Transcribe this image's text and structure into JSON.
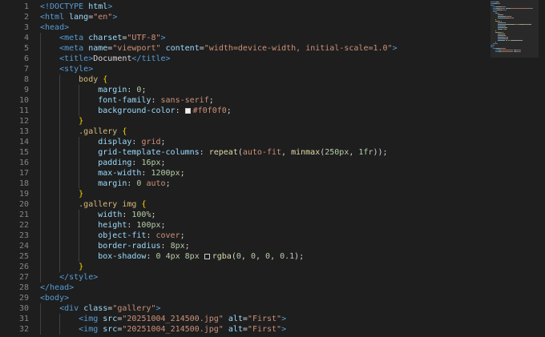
{
  "editor": {
    "lines": [
      {
        "n": "1",
        "indent": 0,
        "tokens": [
          [
            "tag",
            "<!DOCTYPE "
          ],
          [
            "attr",
            "html"
          ],
          [
            "tag",
            ">"
          ]
        ]
      },
      {
        "n": "2",
        "indent": 0,
        "tokens": [
          [
            "tag",
            "<html "
          ],
          [
            "attr",
            "lang"
          ],
          [
            "punct",
            "="
          ],
          [
            "str",
            "\"en\""
          ],
          [
            "tag",
            ">"
          ]
        ]
      },
      {
        "n": "3",
        "indent": 0,
        "tokens": [
          [
            "tag",
            "<head>"
          ]
        ]
      },
      {
        "n": "4",
        "indent": 1,
        "tokens": [
          [
            "tag",
            "<meta "
          ],
          [
            "attr",
            "charset"
          ],
          [
            "punct",
            "="
          ],
          [
            "str",
            "\"UTF-8\""
          ],
          [
            "tag",
            ">"
          ]
        ]
      },
      {
        "n": "5",
        "indent": 1,
        "tokens": [
          [
            "tag",
            "<meta "
          ],
          [
            "attr",
            "name"
          ],
          [
            "punct",
            "="
          ],
          [
            "str",
            "\"viewport\""
          ],
          [
            "text",
            " "
          ],
          [
            "attr",
            "content"
          ],
          [
            "punct",
            "="
          ],
          [
            "str",
            "\"width=device-width, initial-scale=1.0\""
          ],
          [
            "tag",
            ">"
          ]
        ]
      },
      {
        "n": "6",
        "indent": 1,
        "tokens": [
          [
            "tag",
            "<title>"
          ],
          [
            "text",
            "Document"
          ],
          [
            "tag",
            "</title>"
          ]
        ]
      },
      {
        "n": "7",
        "indent": 1,
        "tokens": [
          [
            "tag",
            "<style>"
          ]
        ]
      },
      {
        "n": "8",
        "indent": 2,
        "tokens": [
          [
            "sel",
            "body"
          ],
          [
            "text",
            " "
          ],
          [
            "brace",
            "{"
          ]
        ]
      },
      {
        "n": "9",
        "indent": 3,
        "tokens": [
          [
            "prop",
            "margin"
          ],
          [
            "punct",
            ": "
          ],
          [
            "num",
            "0"
          ],
          [
            "punct",
            ";"
          ]
        ]
      },
      {
        "n": "10",
        "indent": 3,
        "tokens": [
          [
            "prop",
            "font-family"
          ],
          [
            "punct",
            ": "
          ],
          [
            "val",
            "sans-serif"
          ],
          [
            "punct",
            ";"
          ]
        ]
      },
      {
        "n": "11",
        "indent": 3,
        "tokens": [
          [
            "prop",
            "background-color"
          ],
          [
            "punct",
            ": "
          ],
          [
            "swatch",
            "#f0f0f0"
          ],
          [
            "val",
            "#f0f0f0"
          ],
          [
            "punct",
            ";"
          ]
        ]
      },
      {
        "n": "12",
        "indent": 2,
        "tokens": [
          [
            "brace",
            "}"
          ]
        ]
      },
      {
        "n": "13",
        "indent": 2,
        "tokens": [
          [
            "sel",
            ".gallery"
          ],
          [
            "text",
            " "
          ],
          [
            "brace",
            "{"
          ]
        ]
      },
      {
        "n": "14",
        "indent": 3,
        "tokens": [
          [
            "prop",
            "display"
          ],
          [
            "punct",
            ": "
          ],
          [
            "val",
            "grid"
          ],
          [
            "punct",
            ";"
          ]
        ]
      },
      {
        "n": "15",
        "indent": 3,
        "tokens": [
          [
            "prop",
            "grid-template-columns"
          ],
          [
            "punct",
            ": "
          ],
          [
            "fn",
            "repeat"
          ],
          [
            "punct",
            "("
          ],
          [
            "val",
            "auto-fit"
          ],
          [
            "punct",
            ", "
          ],
          [
            "fn",
            "minmax"
          ],
          [
            "punct",
            "("
          ],
          [
            "num",
            "250px"
          ],
          [
            "punct",
            ", "
          ],
          [
            "num",
            "1fr"
          ],
          [
            "punct",
            "));"
          ]
        ]
      },
      {
        "n": "16",
        "indent": 3,
        "tokens": [
          [
            "prop",
            "padding"
          ],
          [
            "punct",
            ": "
          ],
          [
            "num",
            "16px"
          ],
          [
            "punct",
            ";"
          ]
        ]
      },
      {
        "n": "17",
        "indent": 3,
        "tokens": [
          [
            "prop",
            "max-width"
          ],
          [
            "punct",
            ": "
          ],
          [
            "num",
            "1200px"
          ],
          [
            "punct",
            ";"
          ]
        ]
      },
      {
        "n": "18",
        "indent": 3,
        "tokens": [
          [
            "prop",
            "margin"
          ],
          [
            "punct",
            ": "
          ],
          [
            "num",
            "0"
          ],
          [
            "text",
            " "
          ],
          [
            "val",
            "auto"
          ],
          [
            "punct",
            ";"
          ]
        ]
      },
      {
        "n": "19",
        "indent": 2,
        "tokens": [
          [
            "brace",
            "}"
          ]
        ]
      },
      {
        "n": "20",
        "indent": 2,
        "tokens": [
          [
            "sel",
            ".gallery img"
          ],
          [
            "text",
            " "
          ],
          [
            "brace",
            "{"
          ]
        ]
      },
      {
        "n": "21",
        "indent": 3,
        "tokens": [
          [
            "prop",
            "width"
          ],
          [
            "punct",
            ": "
          ],
          [
            "num",
            "100%"
          ],
          [
            "punct",
            ";"
          ]
        ]
      },
      {
        "n": "22",
        "indent": 3,
        "tokens": [
          [
            "prop",
            "height"
          ],
          [
            "punct",
            ": "
          ],
          [
            "num",
            "100px"
          ],
          [
            "punct",
            ";"
          ]
        ]
      },
      {
        "n": "23",
        "indent": 3,
        "tokens": [
          [
            "prop",
            "object-fit"
          ],
          [
            "punct",
            ": "
          ],
          [
            "val",
            "cover"
          ],
          [
            "punct",
            ";"
          ]
        ]
      },
      {
        "n": "24",
        "indent": 3,
        "tokens": [
          [
            "prop",
            "border-radius"
          ],
          [
            "punct",
            ": "
          ],
          [
            "num",
            "8px"
          ],
          [
            "punct",
            ";"
          ]
        ]
      },
      {
        "n": "25",
        "indent": 3,
        "tokens": [
          [
            "prop",
            "box-shadow"
          ],
          [
            "punct",
            ": "
          ],
          [
            "num",
            "0"
          ],
          [
            "text",
            " "
          ],
          [
            "num",
            "4px"
          ],
          [
            "text",
            " "
          ],
          [
            "num",
            "8px"
          ],
          [
            "text",
            " "
          ],
          [
            "swatch",
            "rgba(0,0,0,0.1)"
          ],
          [
            "fn",
            "rgba"
          ],
          [
            "punct",
            "("
          ],
          [
            "num",
            "0"
          ],
          [
            "punct",
            ", "
          ],
          [
            "num",
            "0"
          ],
          [
            "punct",
            ", "
          ],
          [
            "num",
            "0"
          ],
          [
            "punct",
            ", "
          ],
          [
            "num",
            "0.1"
          ],
          [
            "punct",
            ");"
          ]
        ]
      },
      {
        "n": "26",
        "indent": 2,
        "tokens": [
          [
            "brace",
            "}"
          ]
        ]
      },
      {
        "n": "27",
        "indent": 1,
        "tokens": [
          [
            "tag",
            "</style>"
          ]
        ]
      },
      {
        "n": "28",
        "indent": 0,
        "tokens": [
          [
            "tag",
            "</head>"
          ]
        ]
      },
      {
        "n": "29",
        "indent": 0,
        "tokens": [
          [
            "tag",
            "<body>"
          ]
        ]
      },
      {
        "n": "30",
        "indent": 1,
        "tokens": [
          [
            "tag",
            "<div "
          ],
          [
            "attr",
            "class"
          ],
          [
            "punct",
            "="
          ],
          [
            "str",
            "\"gallery\""
          ],
          [
            "tag",
            ">"
          ]
        ]
      },
      {
        "n": "31",
        "indent": 2,
        "tokens": [
          [
            "tag",
            "<img "
          ],
          [
            "attr",
            "src"
          ],
          [
            "punct",
            "="
          ],
          [
            "str",
            "\"20251004_214500.jpg\""
          ],
          [
            "text",
            " "
          ],
          [
            "attr",
            "alt"
          ],
          [
            "punct",
            "="
          ],
          [
            "str",
            "\"First\""
          ],
          [
            "tag",
            ">"
          ]
        ]
      },
      {
        "n": "32",
        "indent": 2,
        "tokens": [
          [
            "tag",
            "<img "
          ],
          [
            "attr",
            "src"
          ],
          [
            "punct",
            "="
          ],
          [
            "str",
            "\"20251004_214500.jpg\""
          ],
          [
            "text",
            " "
          ],
          [
            "attr",
            "alt"
          ],
          [
            "punct",
            "="
          ],
          [
            "str",
            "\"First\""
          ],
          [
            "tag",
            ">"
          ]
        ]
      }
    ]
  },
  "colors": {
    "background": "#1e1e1e",
    "line_number": "#858585",
    "tag": "#569cd6",
    "attribute": "#9cdcfe",
    "string": "#ce9178",
    "selector": "#d7ba7d",
    "number": "#b5cea8",
    "function": "#dcdcaa",
    "brace": "#ffd700"
  }
}
